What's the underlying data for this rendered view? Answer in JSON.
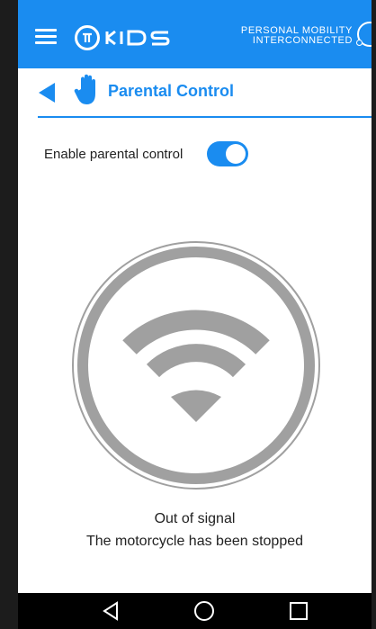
{
  "app": {
    "brand_logo_text": "KIDS",
    "brand_tagline_line1": "PERSONAL MOBILITY",
    "brand_tagline_line2": "INTERCONNECTED"
  },
  "header": {
    "title": "Parental Control"
  },
  "settings": {
    "enable_label": "Enable parental control",
    "enabled": true
  },
  "status": {
    "line1": "Out of signal",
    "line2": "The motorcycle has been stopped"
  },
  "colors": {
    "accent": "#1a8cf0",
    "signal_gray": "#a0a0a0"
  },
  "icons": [
    "menu-icon",
    "logo-icon",
    "back-arrow-icon",
    "hand-icon",
    "wifi-signal-icon",
    "nav-back-icon",
    "nav-home-icon",
    "nav-recents-icon"
  ]
}
